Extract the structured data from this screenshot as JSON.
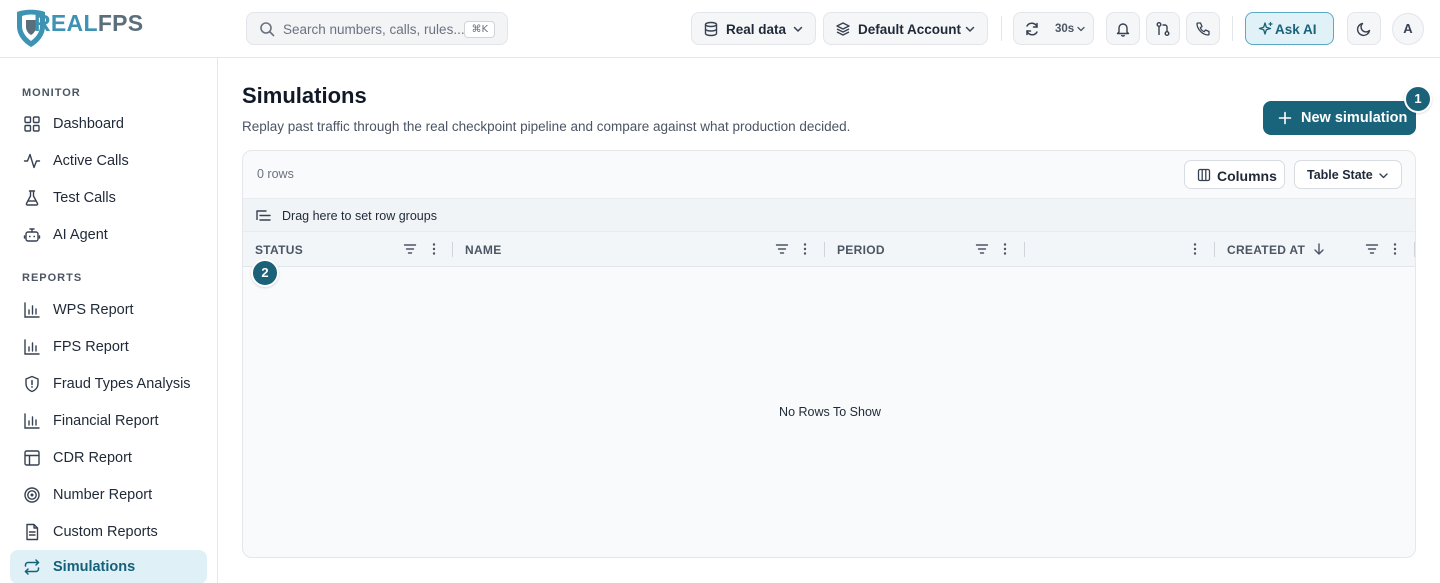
{
  "app": {
    "logo_text_1": "REAL",
    "logo_text_2": "FPS",
    "brand_color": "#1b6178"
  },
  "topbar": {
    "search_placeholder": "Search numbers, calls, rules...",
    "search_shortcut": "⌘K",
    "data_source": "Real data",
    "account": "Default Account",
    "refresh_interval": "30s",
    "ask_ai": "Ask AI",
    "avatar_initial": "A"
  },
  "sidebar": {
    "monitor_title": "MONITOR",
    "monitor_items": [
      {
        "label": "Dashboard",
        "icon": "grid-icon"
      },
      {
        "label": "Active Calls",
        "icon": "activity-icon"
      },
      {
        "label": "Test Calls",
        "icon": "flask-icon"
      },
      {
        "label": "AI Agent",
        "icon": "bot-icon"
      }
    ],
    "reports_title": "REPORTS",
    "reports_items": [
      {
        "label": "WPS Report",
        "icon": "bar-chart-icon"
      },
      {
        "label": "FPS Report",
        "icon": "bar-chart-icon"
      },
      {
        "label": "Fraud Types Analysis",
        "icon": "shield-alert-icon"
      },
      {
        "label": "Financial Report",
        "icon": "bar-chart-icon"
      },
      {
        "label": "CDR Report",
        "icon": "table-icon"
      },
      {
        "label": "Number Report",
        "icon": "target-icon"
      },
      {
        "label": "Custom Reports",
        "icon": "file-text-icon"
      },
      {
        "label": "Simulations",
        "icon": "repeat-icon",
        "active": true
      }
    ]
  },
  "page": {
    "title": "Simulations",
    "subtitle": "Replay past traffic through the real checkpoint pipeline and compare against what production decided.",
    "new_button": "New simulation",
    "badge_1": "1",
    "badge_2": "2"
  },
  "grid": {
    "row_count": "0 rows",
    "columns_button": "Columns",
    "table_state_button": "Table State",
    "group_panel_text": "Drag here to set row groups",
    "columns": [
      {
        "label": "STATUS"
      },
      {
        "label": "NAME"
      },
      {
        "label": "PERIOD"
      },
      {
        "label": ""
      },
      {
        "label": "CREATED AT",
        "sort": "descending"
      }
    ],
    "empty_text": "No Rows To Show"
  }
}
